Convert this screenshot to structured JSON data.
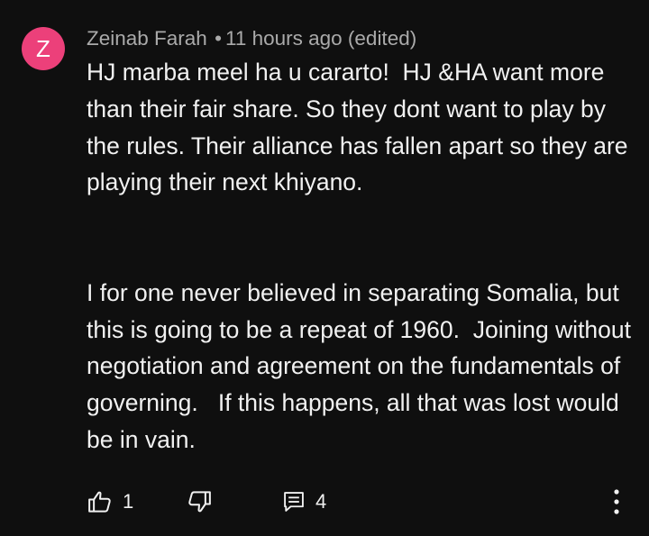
{
  "comment": {
    "avatar_initial": "Z",
    "avatar_color": "#ec407a",
    "author": "Zeinab Farah",
    "separator": "•",
    "time": "11 hours ago (edited)",
    "paragraph_1": "HJ marba meel ha u cararto!  HJ &HA want more than their fair share. So they dont want to play by the rules. Their alliance has fallen apart so they are playing their next khiyano.",
    "paragraph_2": "I for one never believed in separating Somalia, but this is going to be a repeat of 1960.  Joining without negotiation and agreement on the fundamentals of governing.   If this happens, all that was lost would be in vain."
  },
  "actions": {
    "like_icon": "thumbs-up-icon",
    "like_count": "1",
    "dislike_icon": "thumbs-down-icon",
    "reply_icon": "reply-comment-icon",
    "reply_count": "4",
    "more_icon": "more-vertical-icon"
  }
}
